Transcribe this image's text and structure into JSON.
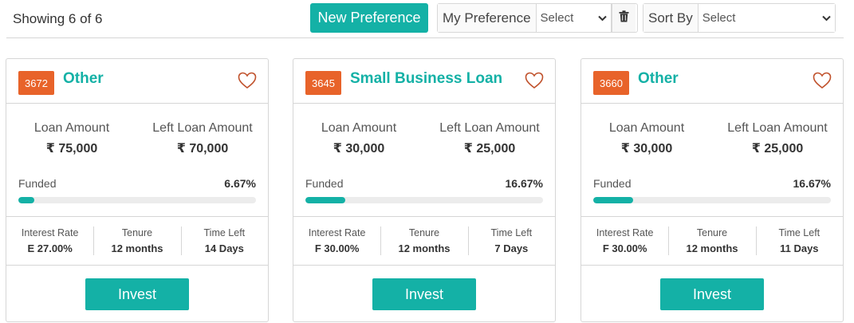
{
  "header": {
    "showing": "Showing 6 of 6",
    "new_preference": "New Preference",
    "my_preference_label": "My Preference",
    "my_preference_value": "Select",
    "sort_by_label": "Sort By",
    "sort_by_value": "Select"
  },
  "icons": {
    "trash": "trash-icon",
    "heart": "heart-outline-icon",
    "chevron": "chevron-down-icon"
  },
  "colors": {
    "accent": "#14b1a6",
    "badge": "#e8632a",
    "heart": "#c0512b"
  },
  "labels": {
    "loan_amount": "Loan Amount",
    "left_loan_amount": "Left Loan Amount",
    "funded": "Funded",
    "interest_rate": "Interest Rate",
    "tenure": "Tenure",
    "time_left": "Time Left",
    "invest": "Invest"
  },
  "cards": [
    {
      "id": "3672",
      "title": "Other",
      "loan_amount": "₹ 75,000",
      "left_amount": "₹ 70,000",
      "funded_pct": "6.67%",
      "funded_fraction": 0.0667,
      "interest": "E 27.00%",
      "tenure": "12 months",
      "time_left": "14 Days"
    },
    {
      "id": "3645",
      "title": "Small Business Loan",
      "loan_amount": "₹ 30,000",
      "left_amount": "₹ 25,000",
      "funded_pct": "16.67%",
      "funded_fraction": 0.1667,
      "interest": "F 30.00%",
      "tenure": "12 months",
      "time_left": "7 Days"
    },
    {
      "id": "3660",
      "title": "Other",
      "loan_amount": "₹ 30,000",
      "left_amount": "₹ 25,000",
      "funded_pct": "16.67%",
      "funded_fraction": 0.1667,
      "interest": "F 30.00%",
      "tenure": "12 months",
      "time_left": "11 Days"
    }
  ]
}
